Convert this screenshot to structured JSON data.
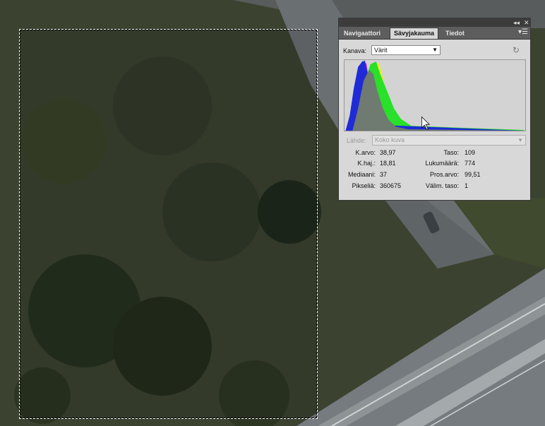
{
  "panel": {
    "tabs": [
      {
        "label": "Navigaattori"
      },
      {
        "label": "Sävyjakauma"
      },
      {
        "label": "Tiedot"
      }
    ],
    "channel_label": "Kanava:",
    "channel_value": "Värit",
    "source_label": "Lähde:",
    "source_value": "Koko kuva",
    "stats_left": [
      {
        "label": "K.arvo:",
        "value": "38,97"
      },
      {
        "label": "K.haj.:",
        "value": "18,81"
      },
      {
        "label": "Mediaani:",
        "value": "37"
      },
      {
        "label": "Pikseliä:",
        "value": "360675"
      }
    ],
    "stats_right": [
      {
        "label": "Taso:",
        "value": "109"
      },
      {
        "label": "Lukumäärä:",
        "value": "774"
      },
      {
        "label": "Pros.arvo:",
        "value": "99,51"
      },
      {
        "label": "Välim. taso:",
        "value": "1"
      }
    ]
  },
  "colors": {
    "panel_bg": "#d8d8d8",
    "hist_blue": "#1f2bd6",
    "hist_green": "#29e02a",
    "hist_yellow": "#f0ef1a",
    "hist_magenta": "#d02ad0",
    "hist_gray": "#6f7a70"
  }
}
